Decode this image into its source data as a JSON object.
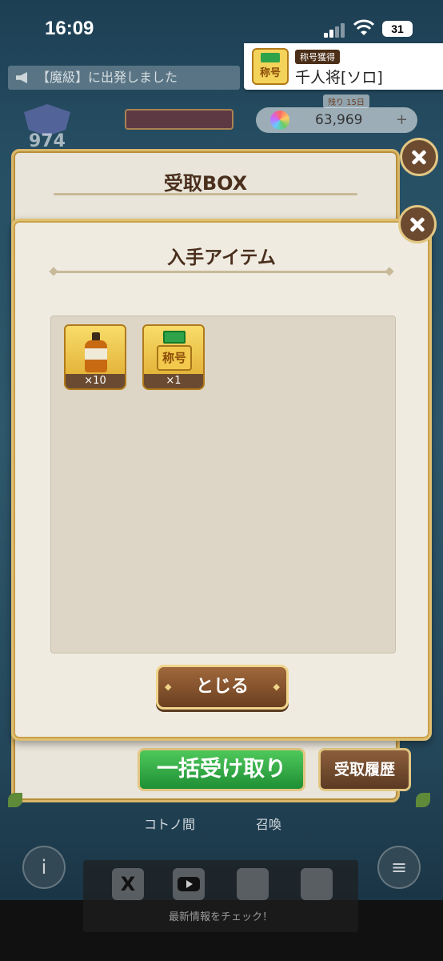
{
  "status_bar": {
    "time": "16:09",
    "battery": "31"
  },
  "notification": {
    "badge": "称号獲得",
    "title": "千人将[ソロ]",
    "icon_text": "称号"
  },
  "background": {
    "ticker_text": "【魔級】に出発しました",
    "rank_number": "974",
    "days_left": "残り 15日",
    "coins": "63,969",
    "coins_plus": "+",
    "nav": {
      "left_label": "コトノ間",
      "right_label": "召喚"
    },
    "info_icon": "i",
    "menu_icon": "≡",
    "footer_caption": "最新情報をチェック！",
    "footer_x": "X"
  },
  "back_modal": {
    "title": "受取BOX",
    "bulk_button": "一括受け取り",
    "history_button": "受取履歴"
  },
  "front_modal": {
    "title": "入手アイテム",
    "items": [
      {
        "name": "drink-bottle",
        "qty": "×10"
      },
      {
        "name": "title-medal",
        "qty": "×1",
        "icon_text": "称号"
      }
    ],
    "close_button": "とじる"
  },
  "colors": {
    "brown_text": "#4a2f1d",
    "gold_border": "#e0c070",
    "green_button": "#2fa34a",
    "panel_bg": "#efebe1"
  }
}
